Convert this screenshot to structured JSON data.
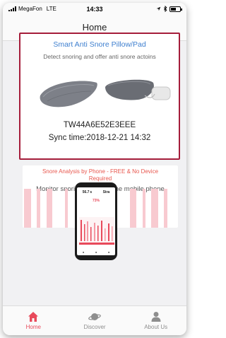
{
  "status_bar": {
    "carrier": "MegaFon",
    "network": "LTE",
    "time": "14:33"
  },
  "nav": {
    "title": "Home"
  },
  "device_card": {
    "title": "Smart Anti Snore Pillow/Pad",
    "subtitle": "Detect snoring and offer anti snore actoins",
    "device_id": "TW44A6E52E3EEE",
    "sync_time": "Sync time:2018-12-21 14:32",
    "accent": "#3e7fcf",
    "border_color": "#a51d3b"
  },
  "phone_card": {
    "title": "Snore Analysis by Phone - FREE & No Device Required",
    "subtitle": "Monitor snoring status by the mobile phone",
    "title_color": "#e8574e",
    "preview": {
      "left_value": "56.7 s",
      "right_value": "Stra",
      "score": "73%"
    }
  },
  "tabs": [
    {
      "label": "Home",
      "icon": "home-icon",
      "active": true
    },
    {
      "label": "Discover",
      "icon": "planet-icon",
      "active": false
    },
    {
      "label": "About Us",
      "icon": "person-icon",
      "active": false
    }
  ],
  "colors": {
    "active_tab": "#e84a5b",
    "inactive_tab": "#8e8e8e"
  }
}
